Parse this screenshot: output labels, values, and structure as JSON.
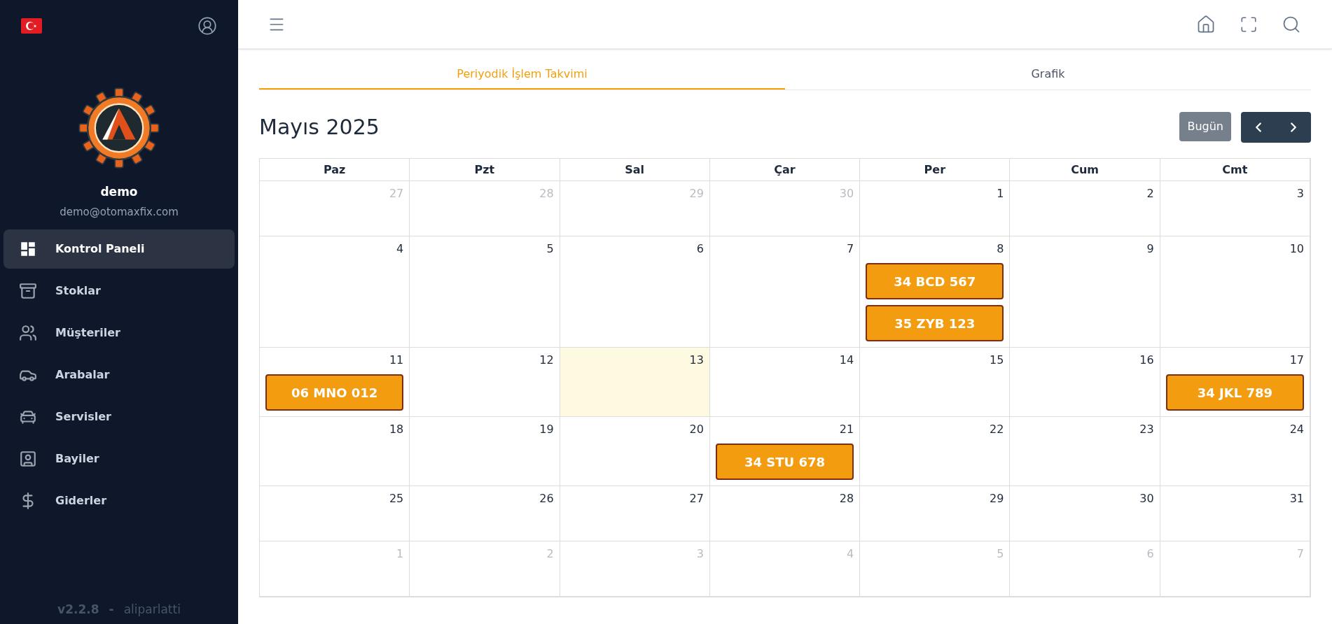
{
  "sidebar": {
    "user": {
      "name": "demo",
      "email": "demo@otomaxfix.com"
    },
    "items": [
      {
        "label": "Kontrol Paneli",
        "selected": true
      },
      {
        "label": "Stoklar",
        "selected": false
      },
      {
        "label": "Müşteriler",
        "selected": false
      },
      {
        "label": "Arabalar",
        "selected": false
      },
      {
        "label": "Servisler",
        "selected": false
      },
      {
        "label": "Bayiler",
        "selected": false
      },
      {
        "label": "Giderler",
        "selected": false
      }
    ],
    "version": "v2.2.8",
    "separator": "-",
    "author": "aliparlatti"
  },
  "tabs": [
    {
      "label": "Periyodik İşlem Takvimi",
      "selected": true
    },
    {
      "label": "Grafik",
      "selected": false
    }
  ],
  "calendar": {
    "title": "Mayıs 2025",
    "today_button": "Bugün",
    "weekdays": [
      "Paz",
      "Pzt",
      "Sal",
      "Çar",
      "Per",
      "Cum",
      "Cmt"
    ],
    "weeks": [
      [
        {
          "day": "27",
          "muted": true
        },
        {
          "day": "28",
          "muted": true
        },
        {
          "day": "29",
          "muted": true
        },
        {
          "day": "30",
          "muted": true
        },
        {
          "day": "1",
          "muted": false
        },
        {
          "day": "2",
          "muted": false
        },
        {
          "day": "3",
          "muted": false
        }
      ],
      [
        {
          "day": "4",
          "muted": false
        },
        {
          "day": "5",
          "muted": false
        },
        {
          "day": "6",
          "muted": false
        },
        {
          "day": "7",
          "muted": false
        },
        {
          "day": "8",
          "muted": false,
          "events": [
            "34 BCD 567",
            "35 ZYB 123"
          ]
        },
        {
          "day": "9",
          "muted": false
        },
        {
          "day": "10",
          "muted": false
        }
      ],
      [
        {
          "day": "11",
          "muted": false,
          "events": [
            "06 MNO 012"
          ]
        },
        {
          "day": "12",
          "muted": false
        },
        {
          "day": "13",
          "muted": false,
          "today": true
        },
        {
          "day": "14",
          "muted": false
        },
        {
          "day": "15",
          "muted": false
        },
        {
          "day": "16",
          "muted": false
        },
        {
          "day": "17",
          "muted": false,
          "events": [
            "34 JKL 789"
          ]
        }
      ],
      [
        {
          "day": "18",
          "muted": false
        },
        {
          "day": "19",
          "muted": false
        },
        {
          "day": "20",
          "muted": false
        },
        {
          "day": "21",
          "muted": false,
          "events": [
            "34 STU 678"
          ]
        },
        {
          "day": "22",
          "muted": false
        },
        {
          "day": "23",
          "muted": false
        },
        {
          "day": "24",
          "muted": false
        }
      ],
      [
        {
          "day": "25",
          "muted": false
        },
        {
          "day": "26",
          "muted": false
        },
        {
          "day": "27",
          "muted": false
        },
        {
          "day": "28",
          "muted": false
        },
        {
          "day": "29",
          "muted": false
        },
        {
          "day": "30",
          "muted": false
        },
        {
          "day": "31",
          "muted": false
        }
      ],
      [
        {
          "day": "1",
          "muted": true
        },
        {
          "day": "2",
          "muted": true
        },
        {
          "day": "3",
          "muted": true
        },
        {
          "day": "4",
          "muted": true
        },
        {
          "day": "5",
          "muted": true
        },
        {
          "day": "6",
          "muted": true
        },
        {
          "day": "7",
          "muted": true
        }
      ]
    ]
  }
}
